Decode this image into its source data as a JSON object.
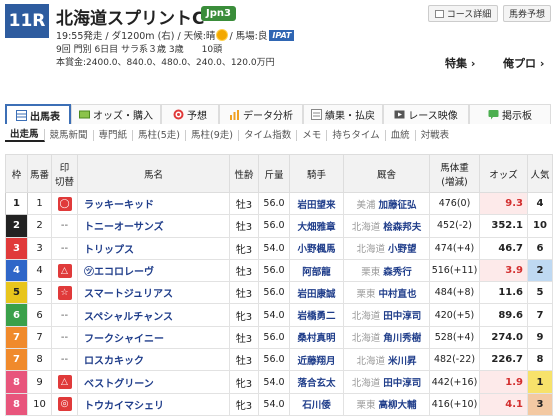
{
  "header": {
    "race_no": "11R",
    "title": "北海道スプリントC",
    "grade": "Jpn3",
    "course_btn": "コース詳細",
    "pred_btn": "馬券予想",
    "info1_pre": "19:55発走 / ダ1200m (右) / 天候:晴",
    "info1_post": "/ 馬場:良",
    "ipat": "IPAT",
    "info2": "9回 門別 6日目 サラ系３歳 3歳　　10頭",
    "info3": "本賞金:2400.0、840.0、480.0、240.0、120.0万円",
    "link_toku": "特集 ›",
    "link_ore": "俺プロ ›",
    "colors": {
      "badge": "#2e5c9f",
      "grade": "#3a8d3a",
      "accent": "#3c6fb6"
    }
  },
  "tabs": [
    {
      "label": "出馬表",
      "icon": "table-icon"
    },
    {
      "label": "オッズ・購入",
      "icon": "ticket-icon"
    },
    {
      "label": "予想",
      "icon": "target-icon"
    },
    {
      "label": "データ分析",
      "icon": "chart-icon"
    },
    {
      "label": "績果・払戻",
      "icon": "result-icon"
    },
    {
      "label": "レース映像",
      "icon": "video-icon"
    },
    {
      "label": "掲示板",
      "icon": "board-icon"
    }
  ],
  "subtabs": [
    "出走馬",
    "競馬新聞",
    "専門紙",
    "馬柱(5走)",
    "馬柱(9走)",
    "タイム指数",
    "メモ",
    "持ちタイム",
    "血統",
    "対戦表"
  ],
  "table": {
    "headers": {
      "waku": "枠",
      "umaban": "馬番",
      "mark": "印",
      "mark_sub": "切替",
      "horse": "馬名",
      "sexage": "性齢",
      "kinryo": "斤量",
      "jockey": "騎手",
      "trainer": "厩舎",
      "bw": "馬体重",
      "bw_sub": "(増減)",
      "odds": "オッズ",
      "pop": "人気"
    },
    "rows": [
      {
        "waku": "1",
        "uma": "1",
        "mark": "◯",
        "horse": "ラッキーキッド",
        "sex": "牡3",
        "kin": "56.0",
        "jockey": "岩田望来",
        "area": "美浦",
        "trainer": "加藤征弘",
        "bw": "476(0)",
        "odds": "9.3",
        "pop": "4",
        "waku_color": "#ffffff",
        "waku_text": "#222222"
      },
      {
        "waku": "2",
        "uma": "2",
        "mark": "--",
        "horse": "トニーオーサンズ",
        "sex": "牡3",
        "kin": "56.0",
        "jockey": "大畑雅章",
        "area": "北海道",
        "trainer": "桧森邦夫",
        "bw": "452(-2)",
        "odds": "352.1",
        "pop": "10",
        "waku_color": "#222222",
        "waku_text": "#ffffff"
      },
      {
        "waku": "3",
        "uma": "3",
        "mark": "--",
        "horse": "トリップス",
        "sex": "牝3",
        "kin": "54.0",
        "jockey": "小野楓馬",
        "area": "北海道",
        "trainer": "小野望",
        "bw": "474(+4)",
        "odds": "46.7",
        "pop": "6",
        "waku_color": "#e03a3a",
        "waku_text": "#ffffff"
      },
      {
        "waku": "4",
        "uma": "4",
        "mark": "△",
        "horse": "㋡エコロレーヴ",
        "sex": "牡3",
        "kin": "56.0",
        "jockey": "阿部龍",
        "area": "栗東",
        "trainer": "森秀行",
        "bw": "516(+11)",
        "odds": "3.9",
        "pop": "2",
        "waku_color": "#2f66c8",
        "waku_text": "#ffffff"
      },
      {
        "waku": "5",
        "uma": "5",
        "mark": "☆",
        "horse": "スマートジュリアス",
        "sex": "牡3",
        "kin": "56.0",
        "jockey": "岩田康誠",
        "area": "栗東",
        "trainer": "中村直也",
        "bw": "484(+8)",
        "odds": "11.6",
        "pop": "5",
        "waku_color": "#e8c51c",
        "waku_text": "#222222"
      },
      {
        "waku": "6",
        "uma": "6",
        "mark": "--",
        "horse": "スペシャルチャンス",
        "sex": "牝3",
        "kin": "54.0",
        "jockey": "岩橋勇二",
        "area": "北海道",
        "trainer": "田中淳司",
        "bw": "420(+5)",
        "odds": "89.6",
        "pop": "7",
        "waku_color": "#3aa04a",
        "waku_text": "#ffffff"
      },
      {
        "waku": "7",
        "uma": "7",
        "mark": "--",
        "horse": "フークシャイニー",
        "sex": "牡3",
        "kin": "56.0",
        "jockey": "桑村真明",
        "area": "北海道",
        "trainer": "角川秀樹",
        "bw": "528(+4)",
        "odds": "274.0",
        "pop": "9",
        "waku_color": "#f08a2c",
        "waku_text": "#ffffff"
      },
      {
        "waku": "7",
        "uma": "8",
        "mark": "--",
        "horse": "ロスカキック",
        "sex": "牡3",
        "kin": "56.0",
        "jockey": "近藤翔月",
        "area": "北海道",
        "trainer": "米川昇",
        "bw": "482(-22)",
        "odds": "226.7",
        "pop": "8",
        "waku_color": "#f08a2c",
        "waku_text": "#ffffff"
      },
      {
        "waku": "8",
        "uma": "9",
        "mark": "△",
        "horse": "ベストグリーン",
        "sex": "牝3",
        "kin": "54.0",
        "jockey": "落合玄太",
        "area": "北海道",
        "trainer": "田中淳司",
        "bw": "442(+16)",
        "odds": "1.9",
        "pop": "1",
        "waku_color": "#e8557c",
        "waku_text": "#ffffff"
      },
      {
        "waku": "8",
        "uma": "10",
        "mark": "◎",
        "horse": "トウカイマシェリ",
        "sex": "牝3",
        "kin": "54.0",
        "jockey": "石川倭",
        "area": "栗東",
        "trainer": "高柳大輔",
        "bw": "416(+10)",
        "odds": "4.1",
        "pop": "3",
        "waku_color": "#e8557c",
        "waku_text": "#ffffff"
      }
    ]
  }
}
